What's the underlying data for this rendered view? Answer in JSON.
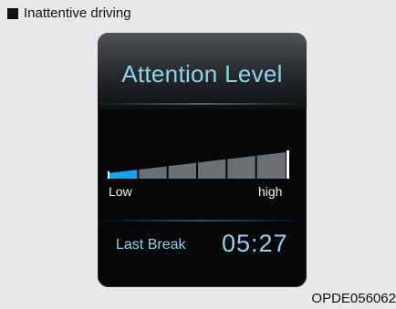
{
  "caption": {
    "text": "Inattentive driving"
  },
  "display": {
    "title": "Attention Level",
    "meter": {
      "low_label": "Low",
      "high_label": "high",
      "segments": 6,
      "active_segments": 1,
      "active_color": "#1aa3e8"
    },
    "last_break_label": "Last Break",
    "last_break_time": "05:27"
  },
  "figure_code": "OPDE056062"
}
